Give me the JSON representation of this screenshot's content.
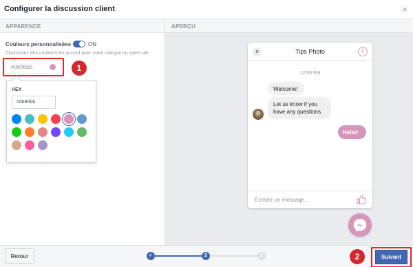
{
  "window": {
    "title": "Configurer la discussion client",
    "close_glyph": "×"
  },
  "left_panel": {
    "section_title": "APPARENCE",
    "custom_colors_label": "Couleurs personnalisées",
    "toggle_state": "ON",
    "help_text": "Choisissez des couleurs en accord avec votre marque ou votre site.",
    "color_value": "#d696bb",
    "selected_color": "#d696bb",
    "badge_1": "1"
  },
  "color_picker": {
    "hex_label": "HEX",
    "hex_value": "#d696bb",
    "swatches": [
      "#0084ff",
      "#44bec7",
      "#ffc300",
      "#fa3c4c",
      "#d696bb",
      "#6699cc",
      "#13cf13",
      "#ff7e29",
      "#e68585",
      "#7646ff",
      "#20cef5",
      "#67b868",
      "#d4a88c",
      "#ff5ca1",
      "#a695c7"
    ]
  },
  "preview": {
    "section_title": "APERÇU",
    "chat_title": "Tips Photo",
    "close_glyph": "×",
    "info_glyph": "i",
    "time": "12:00 PM",
    "bubble_1": "Welcome!",
    "bubble_2": "Let us know if you have any questions.",
    "bubble_3": "Hello!",
    "avatar_letter": "P",
    "compose_placeholder": "Écrivez un message...",
    "accent_color": "#d696bb"
  },
  "footer": {
    "back_label": "Retour",
    "next_label": "Suivant",
    "steps": [
      "✓",
      "2",
      "3"
    ],
    "current_step": 2,
    "badge_2": "2"
  }
}
